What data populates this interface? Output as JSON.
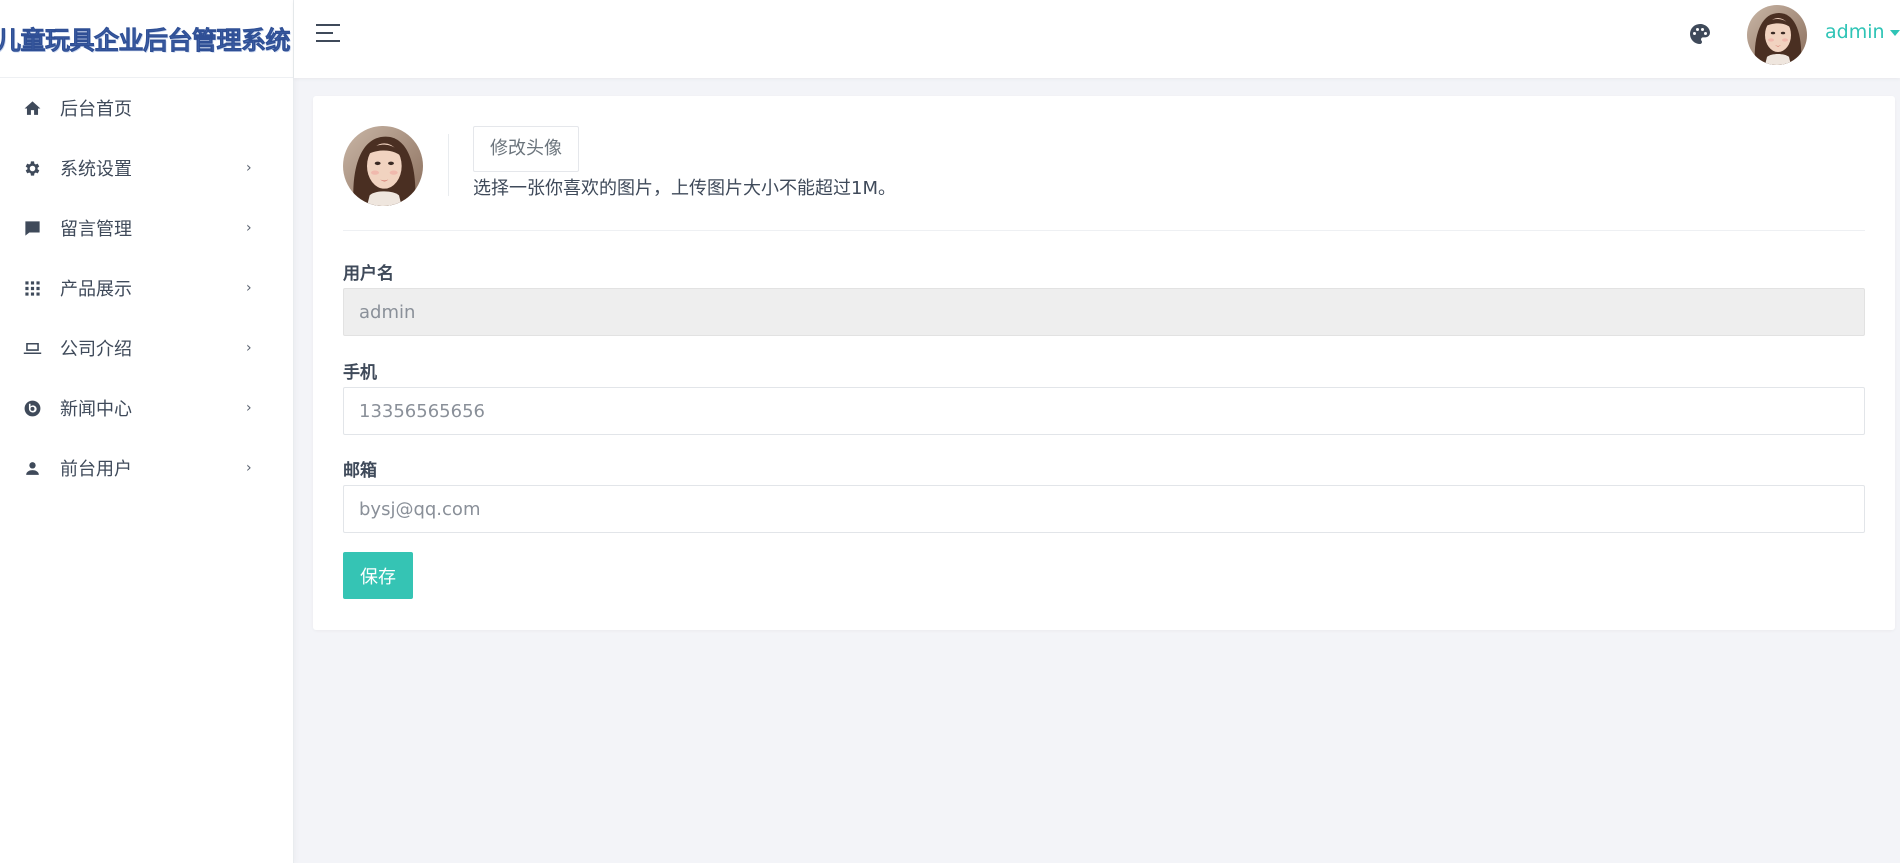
{
  "app": {
    "title": "儿童玩具企业后台管理系统"
  },
  "sidebar": {
    "items": [
      {
        "label": "后台首页",
        "icon": "home-icon",
        "has_arrow": false
      },
      {
        "label": "系统设置",
        "icon": "gear-icon",
        "has_arrow": true
      },
      {
        "label": "留言管理",
        "icon": "message-icon",
        "has_arrow": true
      },
      {
        "label": "产品展示",
        "icon": "grid-icon",
        "has_arrow": true
      },
      {
        "label": "公司介绍",
        "icon": "laptop-icon",
        "has_arrow": true
      },
      {
        "label": "新闻中心",
        "icon": "news-icon",
        "has_arrow": true
      },
      {
        "label": "前台用户",
        "icon": "user-icon",
        "has_arrow": true
      }
    ],
    "arrow_glyph": "›"
  },
  "topbar": {
    "username": "admin",
    "icons": [
      "menu-toggle-icon",
      "palette-icon",
      "chevron-down-icon"
    ]
  },
  "profile": {
    "change_avatar_label": "修改头像",
    "hint": "选择一张你喜欢的图片，上传图片大小不能超过1M。"
  },
  "form": {
    "username": {
      "label": "用户名",
      "value": "admin"
    },
    "phone": {
      "label": "手机",
      "value": "13356565656"
    },
    "email": {
      "label": "邮箱",
      "value": "bysj@qq.com"
    },
    "save_label": "保存"
  },
  "colors": {
    "accent": "#35c4b4",
    "link": "#2ec4b6",
    "brand": "#4a6fb5",
    "background": "#f3f4f8"
  }
}
